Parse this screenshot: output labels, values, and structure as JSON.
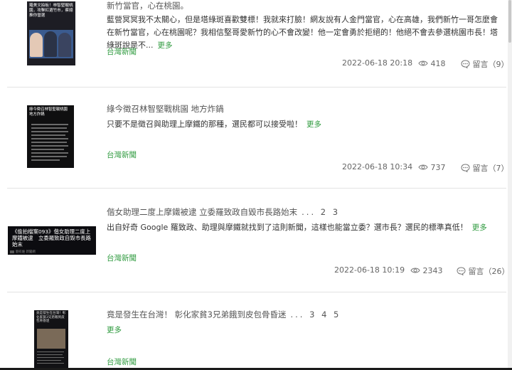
{
  "posts": [
    {
      "thumb_text": "羅美文拍板！林智堅戰桃園，攻擊紅選竹市，蔡總推你當選",
      "title": "新竹當官，心在桃園。",
      "excerpt": "藍營冥冥我不太關心，但是塔綠斑喜歡雙標！我就來打臉！網友說有人金門當官，心在高雄，我們新竹一哥怎麼會在新竹當官，心在桃園呢？我相信堅哥愛新竹的心不會改變！他一定會勇於拒絕的！他絕不會去參選桃園市長！塔綠斑說是不...",
      "more": "更多",
      "source": "台灣新聞",
      "date": "2022-06-18 20:18",
      "views": "418",
      "comments": "留言（9）"
    },
    {
      "thumb_text": "綠今徵召林智堅戰桃園 地方炸鍋",
      "title": "綠今徵召林智堅戰桃園 地方炸鍋",
      "excerpt": "只要不是徵召與助理上摩鐵的那種，選民都可以接受啦！",
      "more": "更多",
      "source": "台灣新聞",
      "date": "2022-06-18 10:34",
      "views": "737",
      "comments": "留言（7）"
    },
    {
      "thumb_text": "《偷拍檔案093》偕女助理二度上摩鐵被逮　立委羅致政自毀市長路始末",
      "thumb_footer": "劉有維 新聞網",
      "title": "偕女助理二度上摩鐵被逮 立委羅致政自毀市長路始末",
      "pages": "... 2 3",
      "excerpt": "出自好奇 Google 羅致政、助理與摩鐵就找到了這則新聞，這樣也能當立委？選市長？選民的標準真低！",
      "more": "更多",
      "source": "台灣新聞",
      "date": "2022-06-18 10:19",
      "views": "2343",
      "comments": "留言（26）"
    },
    {
      "thumb_text": "竟是發生在台灣！彰化家貧3兄弟餓到皮包骨昏迷",
      "title": "竟是發生在台灣！ 彰化家貧3兄弟餓到皮包骨昏迷",
      "pages": "... 3 4 5",
      "excerpt": "",
      "more": "更多",
      "source": "台灣新聞"
    }
  ],
  "colors": {
    "accent": "#2e9a3e",
    "divider": "#e3e3e3"
  },
  "icons": {
    "views": "eye-icon",
    "comments": "comment-bubble-icon"
  }
}
